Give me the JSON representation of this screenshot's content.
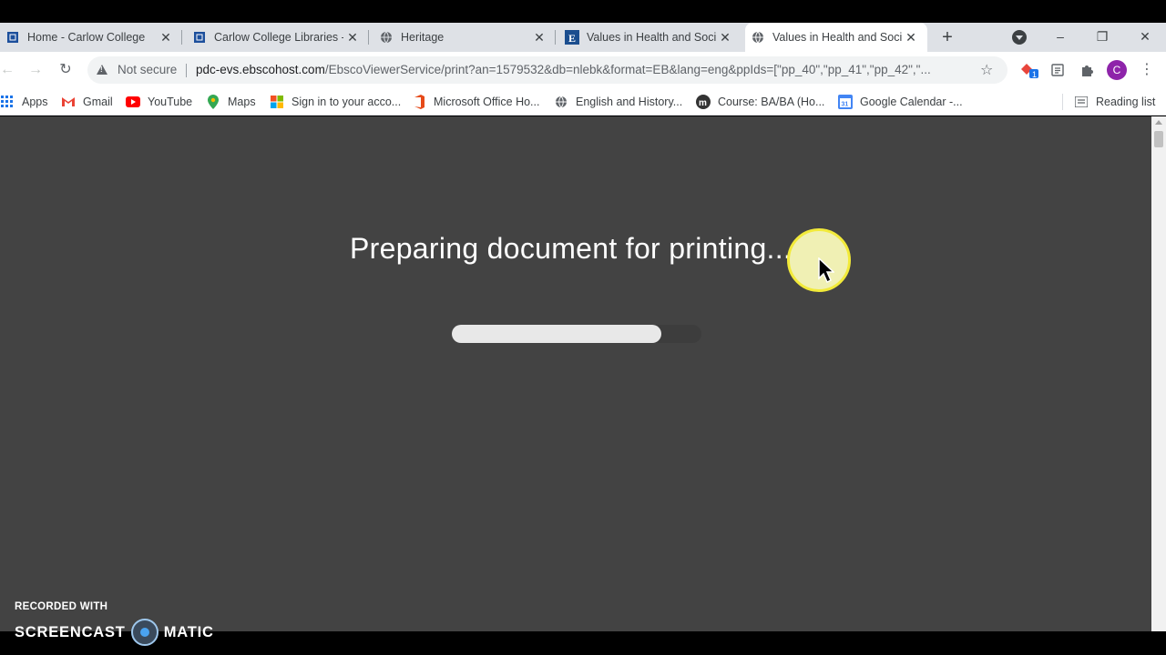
{
  "tabs": [
    {
      "title": "Home - Carlow College",
      "favicon": "carlow-crest-icon",
      "active": false
    },
    {
      "title": "Carlow College Libraries -",
      "favicon": "carlow-crest-icon",
      "active": false
    },
    {
      "title": "Heritage",
      "favicon": "globe-icon",
      "active": false
    },
    {
      "title": "Values in Health and Socia",
      "favicon": "ebsco-e-icon",
      "active": false
    },
    {
      "title": "Values in Health and Socia",
      "favicon": "globe-icon",
      "active": true
    }
  ],
  "tab_close_glyph": "✕",
  "new_tab_glyph": "+",
  "window": {
    "minimize": "–",
    "restore": "❐",
    "close": "✕"
  },
  "toolbar": {
    "back": "←",
    "forward": "→",
    "reload": "↻",
    "security_label": "Not secure",
    "url_host": "pdc-evs.ebscohost.com",
    "url_path": "/EbscoViewerService/print?an=1579532&db=nlebk&format=EB&lang=eng&ppIds=[\"pp_40\",\"pp_41\",\"pp_42\",\"...",
    "star": "☆",
    "profile_initial": "C",
    "extension_badge": "1",
    "menu": "⋮"
  },
  "bookmarks": [
    {
      "label": "Apps",
      "icon": "apps-grid-icon"
    },
    {
      "label": "Gmail",
      "icon": "gmail-icon"
    },
    {
      "label": "YouTube",
      "icon": "youtube-icon"
    },
    {
      "label": "Maps",
      "icon": "maps-icon"
    },
    {
      "label": "Sign in to your acco...",
      "icon": "microsoft-icon"
    },
    {
      "label": "Microsoft Office Ho...",
      "icon": "office-icon"
    },
    {
      "label": "English and History...",
      "icon": "globe-icon"
    },
    {
      "label": "Course: BA/BA (Ho...",
      "icon": "moodle-icon"
    },
    {
      "label": "Google Calendar -...",
      "icon": "calendar-icon"
    }
  ],
  "calendar_day": "31",
  "reading_list": "Reading list",
  "content": {
    "message": "Preparing document for printing...",
    "progress_fraction": 0.84
  },
  "watermark": {
    "line1": "RECORDED WITH",
    "line2_left": "SCREENCAST",
    "line2_right": "MATIC"
  },
  "colors": {
    "content_bg": "#434343",
    "progress_fill": "#e8e8e8",
    "cursor_highlight": "#f2ea3a",
    "avatar": "#8e24aa"
  }
}
